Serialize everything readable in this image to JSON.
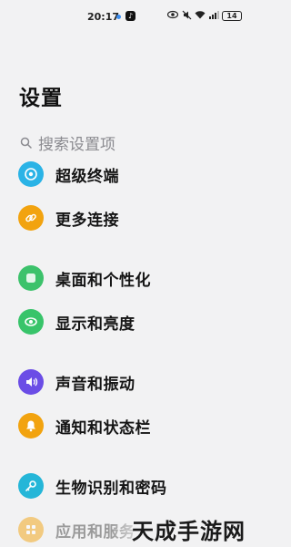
{
  "status_bar": {
    "time": "20:17",
    "battery": "14"
  },
  "title": "设置",
  "search": {
    "placeholder": "搜索设置项"
  },
  "items": [
    {
      "label": "超级终端",
      "icon": "super-terminal-icon",
      "color": "#2ab3e6"
    },
    {
      "label": "更多连接",
      "icon": "link-icon",
      "color": "#f2a30f"
    },
    {
      "label": "桌面和个性化",
      "icon": "desktop-icon",
      "color": "#3cc26b"
    },
    {
      "label": "显示和亮度",
      "icon": "eye-icon",
      "color": "#38c46a"
    },
    {
      "label": "声音和振动",
      "icon": "sound-icon",
      "color": "#6b4de6"
    },
    {
      "label": "通知和状态栏",
      "icon": "bell-icon",
      "color": "#f2a30f"
    },
    {
      "label": "生物识别和密码",
      "icon": "key-icon",
      "color": "#25b6d8"
    },
    {
      "label": "应用和服务",
      "icon": "apps-icon",
      "color": "#f2a30f"
    }
  ],
  "watermark": "天成手游网"
}
